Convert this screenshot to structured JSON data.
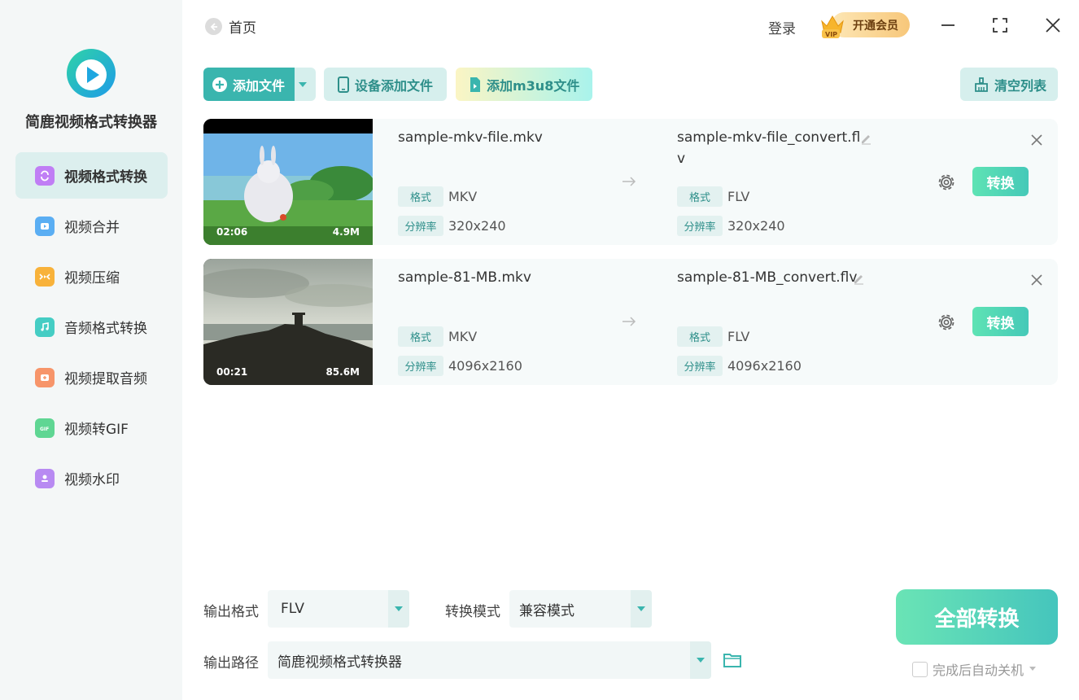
{
  "app": {
    "name": "简鹿视频格式转换器",
    "brand_color": "#3ab5ae",
    "logo_icon": "play-logo-icon"
  },
  "sidebar": {
    "items": [
      {
        "label": "视频格式转换",
        "icon": "convert-icon",
        "color": "#b36cf2",
        "active": true
      },
      {
        "label": "视频合并",
        "icon": "merge-icon",
        "color": "#4aa3f0",
        "active": false
      },
      {
        "label": "视频压缩",
        "icon": "compress-icon",
        "color": "#f6a623",
        "active": false
      },
      {
        "label": "音频格式转换",
        "icon": "music-icon",
        "color": "#3fc8c0",
        "active": false
      },
      {
        "label": "视频提取音频",
        "icon": "extract-audio-icon",
        "color": "#f58a5a",
        "active": false
      },
      {
        "label": "视频转GIF",
        "icon": "gif-icon",
        "color": "#5ad28c",
        "active": false
      },
      {
        "label": "视频水印",
        "icon": "watermark-icon",
        "color": "#b07ef0",
        "active": false
      }
    ]
  },
  "header": {
    "home_label": "首页",
    "login_label": "登录",
    "vip_label": "开通会员",
    "vip_badge": "VIP"
  },
  "toolbar": {
    "add_file": "添加文件",
    "device_add": "设备添加文件",
    "add_m3u8": "添加m3u8文件",
    "clear_list": "清空列表"
  },
  "labels": {
    "format": "格式",
    "resolution": "分辨率",
    "convert": "转换"
  },
  "files": [
    {
      "source_name": "sample-mkv-file.mkv",
      "output_name_line1": "sample-mkv-file_convert.fl",
      "output_name_line2": "v",
      "duration": "02:06",
      "size": "4.9M",
      "source_format": "MKV",
      "output_format": "FLV",
      "source_resolution": "320x240",
      "output_resolution": "320x240"
    },
    {
      "source_name": "sample-81-MB.mkv",
      "output_name_line1": "sample-81-MB_convert.flv",
      "output_name_line2": "",
      "duration": "00:21",
      "size": "85.6M",
      "source_format": "MKV",
      "output_format": "FLV",
      "source_resolution": "4096x2160",
      "output_resolution": "4096x2160"
    }
  ],
  "bottom": {
    "output_format_label": "输出格式",
    "output_format_value": "FLV",
    "mode_label": "转换模式",
    "mode_value": "兼容模式",
    "path_label": "输出路径",
    "path_value": "简鹿视频格式转换器",
    "convert_all": "全部转换",
    "auto_shutdown": "完成后自动关机"
  }
}
